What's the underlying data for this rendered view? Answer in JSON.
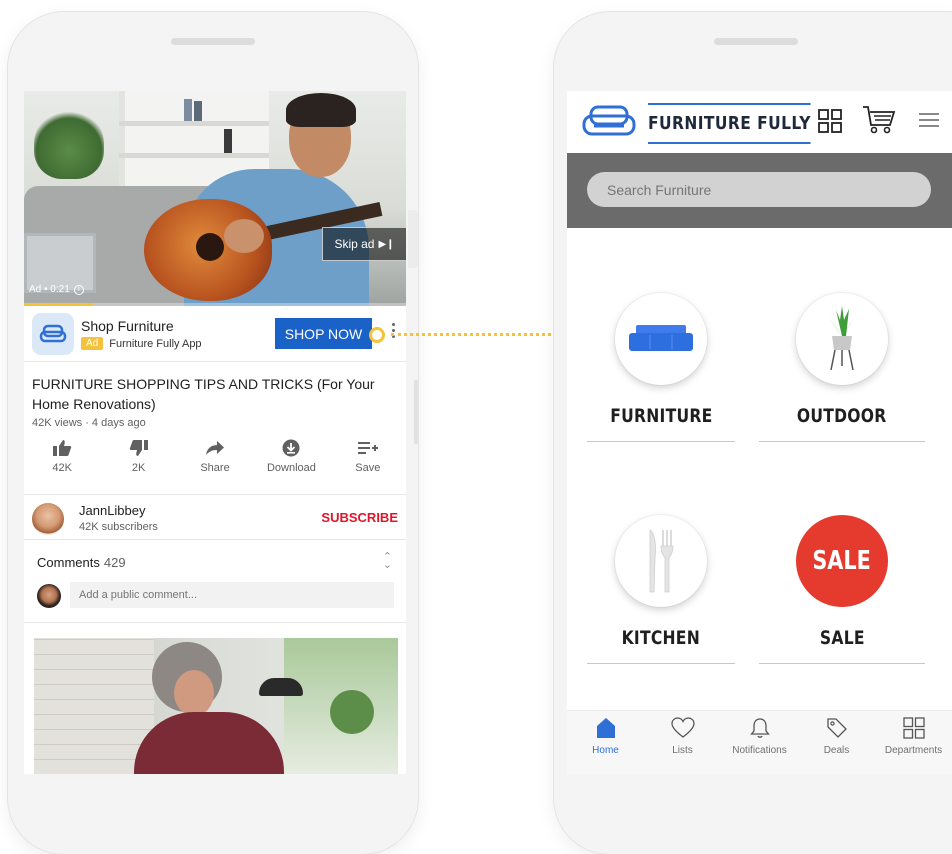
{
  "left_phone": {
    "video": {
      "ad_time": "Ad • 0:21",
      "skip_label": "Skip ad",
      "progress": 0.18
    },
    "ad": {
      "title": "Shop Furniture",
      "badge": "Ad",
      "advertiser": "Furniture Fully App",
      "cta": "SHOP NOW"
    },
    "video_info": {
      "title": "FURNITURE SHOPPING TIPS AND TRICKS (For Your Home Renovations)",
      "meta": "42K views · 4 days ago"
    },
    "actions": [
      {
        "icon": "thumbs-up-icon",
        "label": "42K"
      },
      {
        "icon": "thumbs-down-icon",
        "label": "2K"
      },
      {
        "icon": "share-icon",
        "label": "Share"
      },
      {
        "icon": "download-icon",
        "label": "Download"
      },
      {
        "icon": "save-to-playlist-icon",
        "label": "Save"
      }
    ],
    "channel": {
      "name": "JannLibbey",
      "subscribers": "42K subscribers",
      "subscribe_label": "SUBSCRIBE"
    },
    "comments": {
      "label": "Comments",
      "count": "429",
      "placeholder": "Add a public comment..."
    }
  },
  "right_phone": {
    "brand": "FURNITURE FULLY",
    "search": {
      "placeholder": "Search Furniture"
    },
    "categories": [
      {
        "label": "FURNITURE",
        "icon": "sofa-icon"
      },
      {
        "label": "OUTDOOR",
        "icon": "potted-plant-icon"
      },
      {
        "label": "KITCHEN",
        "icon": "fork-knife-icon"
      },
      {
        "label": "SALE",
        "icon_text": "SALE"
      }
    ],
    "tabs": [
      {
        "label": "Home",
        "icon": "home-icon",
        "active": true
      },
      {
        "label": "Lists",
        "icon": "heart-icon"
      },
      {
        "label": "Notifications",
        "icon": "bell-icon"
      },
      {
        "label": "Deals",
        "icon": "tag-icon"
      },
      {
        "label": "Departments",
        "icon": "grid-icon"
      }
    ]
  },
  "colors": {
    "accent_yellow": "#f5c23b",
    "cta_blue": "#1a62c8",
    "brand_blue": "#2f6fd6",
    "subscribe_red": "#e0152b",
    "sale_red": "#e53a2e"
  }
}
